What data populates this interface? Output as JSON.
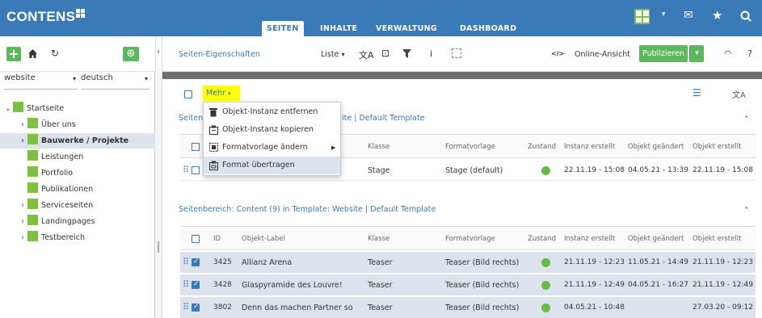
{
  "app": {
    "title": "CONTENS"
  },
  "nav": {
    "tabs": [
      {
        "label": "SEITEN",
        "active": true
      },
      {
        "label": "INHALTE"
      },
      {
        "label": "VERWALTUNG"
      },
      {
        "label": "DASHBOARD"
      }
    ]
  },
  "toolbar": {
    "section_title": "Seiten-Eigenschaften",
    "view_label": "Liste",
    "online_label": "Online-Ansicht",
    "publish_label": "Publizieren",
    "code_icon": "</>",
    "info_icon": "i",
    "help_icon": "?"
  },
  "sidebar": {
    "site_select": "website",
    "lang_select": "deutsch",
    "items": [
      {
        "label": "Startseite"
      },
      {
        "label": "Über uns"
      },
      {
        "label": "Bauwerke / Projekte",
        "active": true
      },
      {
        "label": "Leistungen"
      },
      {
        "label": "Portfolio"
      },
      {
        "label": "Publikationen"
      },
      {
        "label": "Serviceseiten"
      },
      {
        "label": "Landingpages"
      },
      {
        "label": "Testbereich"
      }
    ]
  },
  "main": {
    "mehr_label": "Mehr",
    "section1_title_start": "Seiten",
    "section1_title_end": "ite | Default Template",
    "section2_title": "Seitenbereich: Content (9) in Template: Website | Default Template",
    "columns": [
      "ID",
      "Objekt-Label",
      "Klasse",
      "Formatvorlage",
      "Zustand",
      "Instanz erstellt",
      "Objekt geändert",
      "Objekt erstellt"
    ],
    "section1_rows": [
      {
        "klasse": "Stage",
        "format": "Stage (default)",
        "instanz": "22.11.19 - 15:08",
        "geaendert": "04.05.21 - 13:39",
        "erstellt": "22.11.19 - 15:08"
      }
    ],
    "section2_rows": [
      {
        "id": "3425",
        "label": "Allianz Arena",
        "klasse": "Teaser",
        "format": "Teaser (Bild rechts)",
        "instanz": "21.11.19 - 12:23",
        "geaendert": "11.05.21 - 14:49",
        "erstellt": "21.11.19 - 12:23"
      },
      {
        "id": "3428",
        "label": "Glaspyramide des Louvre!",
        "klasse": "Teaser",
        "format": "Teaser (Bild rechts)",
        "instanz": "21.11.19 - 12:49",
        "geaendert": "04.05.21 - 16:27",
        "erstellt": "21.11.19 - 12:49"
      },
      {
        "id": "3802",
        "label": "Denn das machen Partner so",
        "klasse": "Teaser",
        "format": "Teaser (Bild rechts)",
        "instanz": "04.05.21 - 10:48",
        "geaendert": "",
        "erstellt": "27.03.20 - 09:12"
      }
    ]
  },
  "menu": {
    "items": [
      {
        "label": "Objekt-Instanz entfernen",
        "icon": "trash-icon"
      },
      {
        "label": "Objekt-Instanz kopieren",
        "icon": "copy-icon"
      },
      {
        "label": "Formatvorlage ändern",
        "icon": "format-icon",
        "submenu": true
      },
      {
        "label": "Format übertragen",
        "icon": "paste-format-icon",
        "highlighted": true
      }
    ]
  },
  "colors": {
    "brand": "#3a7ab8",
    "green": "#5cb85c",
    "highlight": "#ffff00",
    "status_ok": "#66bb44"
  }
}
